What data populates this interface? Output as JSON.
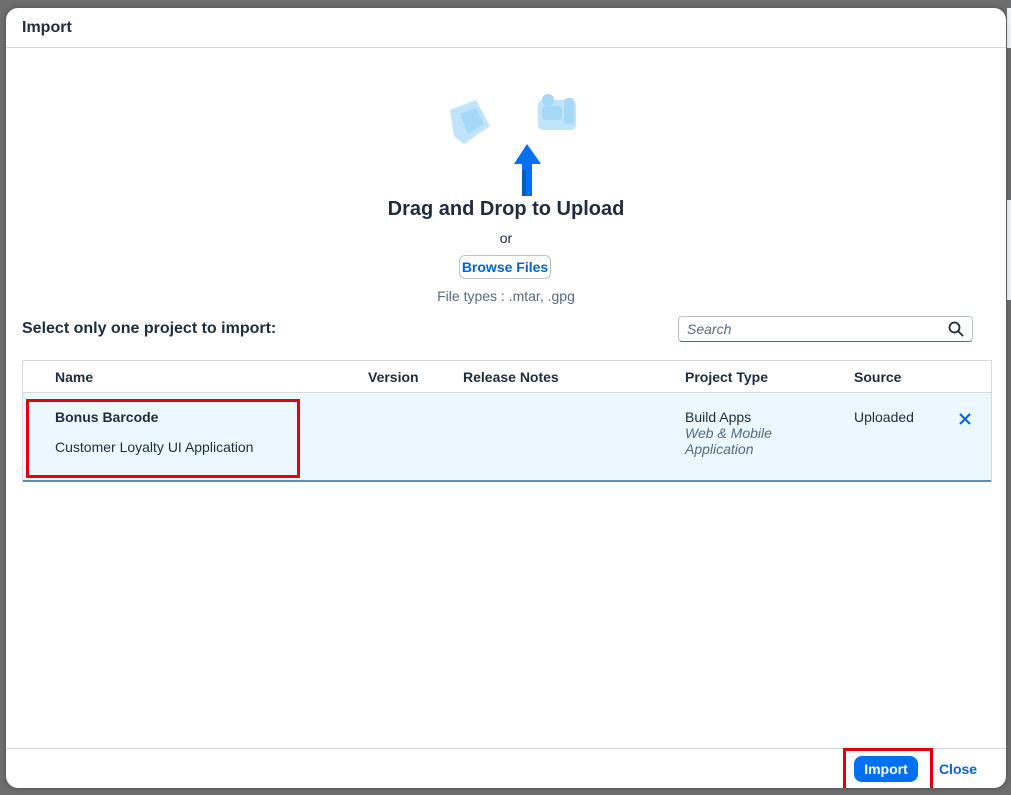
{
  "dialog": {
    "title": "Import"
  },
  "upload": {
    "title": "Drag and Drop to Upload",
    "or": "or",
    "browse_label": "Browse Files",
    "file_types": "File types : .mtar, .gpg"
  },
  "select_label": "Select only one project to import:",
  "search": {
    "placeholder": "Search",
    "value": ""
  },
  "table": {
    "columns": [
      "Name",
      "Version",
      "Release Notes",
      "Project Type",
      "Source"
    ],
    "rows": [
      {
        "name": "Bonus Barcode",
        "description": "Customer Loyalty UI Application",
        "version": "",
        "release_notes": "",
        "project_type": "Build Apps",
        "project_subtype_1": "Web & Mobile",
        "project_subtype_2": "Application",
        "source": "Uploaded"
      }
    ]
  },
  "footer": {
    "import_label": "Import",
    "close_label": "Close"
  },
  "colors": {
    "accent": "#0070f2",
    "link": "#0064d9",
    "row_selected": "#ebf8ff",
    "highlight": "#e0000f"
  },
  "icons": {
    "illustration": "upload-illustration",
    "search": "search-icon",
    "remove": "close-icon"
  }
}
